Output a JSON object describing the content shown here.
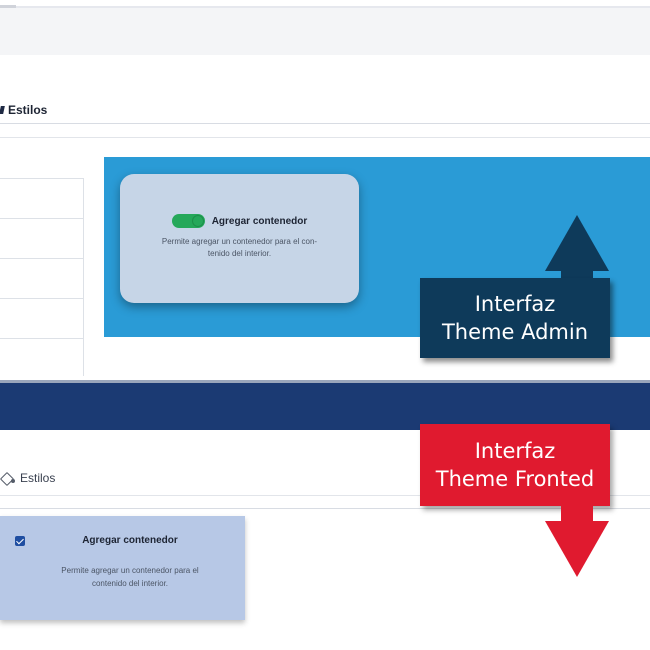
{
  "admin": {
    "tab_label": "Estilos",
    "card": {
      "title": "Agregar contenedor",
      "description": "Permite agregar un contenedor para el con-\ntenido del interior.",
      "toggle_on": true
    },
    "callout_line1": "Interfaz",
    "callout_line2": "Theme Admin"
  },
  "frontend": {
    "tab_label": "Estilos",
    "card": {
      "title": "Agregar contenedor",
      "description": "Permite agregar un contenedor para el\ncontenido del interior.",
      "checked": true
    },
    "callout_line1": "Interfaz",
    "callout_line2": "Theme Fronted"
  },
  "colors": {
    "admin_panel": "#2a9bd6",
    "admin_callout": "#0e3a5a",
    "front_callout": "#e01a2f",
    "divider_band": "#1b3a73",
    "toggle": "#25a85a"
  }
}
